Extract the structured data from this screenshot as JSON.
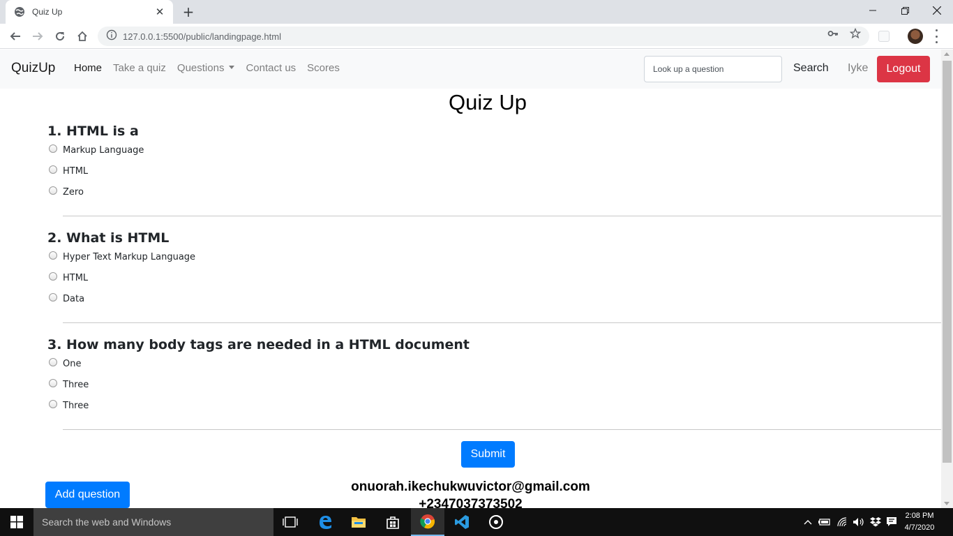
{
  "browser": {
    "tab_title": "Quiz Up",
    "url": "127.0.0.1:5500/public/landingpage.html"
  },
  "navbar": {
    "brand": "QuizUp",
    "links": [
      "Home",
      "Take a quiz",
      "Questions",
      "Contact us",
      "Scores"
    ],
    "search_placeholder": "Look up a question",
    "search_label": "Search",
    "user": "Iyke",
    "logout_label": "Logout"
  },
  "page": {
    "title": "Quiz Up",
    "questions": [
      {
        "title": "1. HTML is a",
        "options": [
          "Markup Language",
          "HTML",
          "Zero"
        ]
      },
      {
        "title": "2. What is HTML",
        "options": [
          "Hyper Text Markup Language",
          "HTML",
          "Data"
        ]
      },
      {
        "title": "3. How many body tags are needed in a HTML document",
        "options": [
          "One",
          "Three",
          "Three"
        ]
      }
    ],
    "submit_label": "Submit",
    "add_question_label": "Add question",
    "contact_email": "onuorah.ikechukwuvictor@gmail.com",
    "contact_phone": "+2347037373502"
  },
  "taskbar": {
    "search_placeholder": "Search the web and Windows",
    "time": "2:08 PM",
    "date": "4/7/2020"
  },
  "colors": {
    "danger": "#dc3545",
    "primary": "#007bff",
    "navbar_bg": "#f8f9fa"
  }
}
